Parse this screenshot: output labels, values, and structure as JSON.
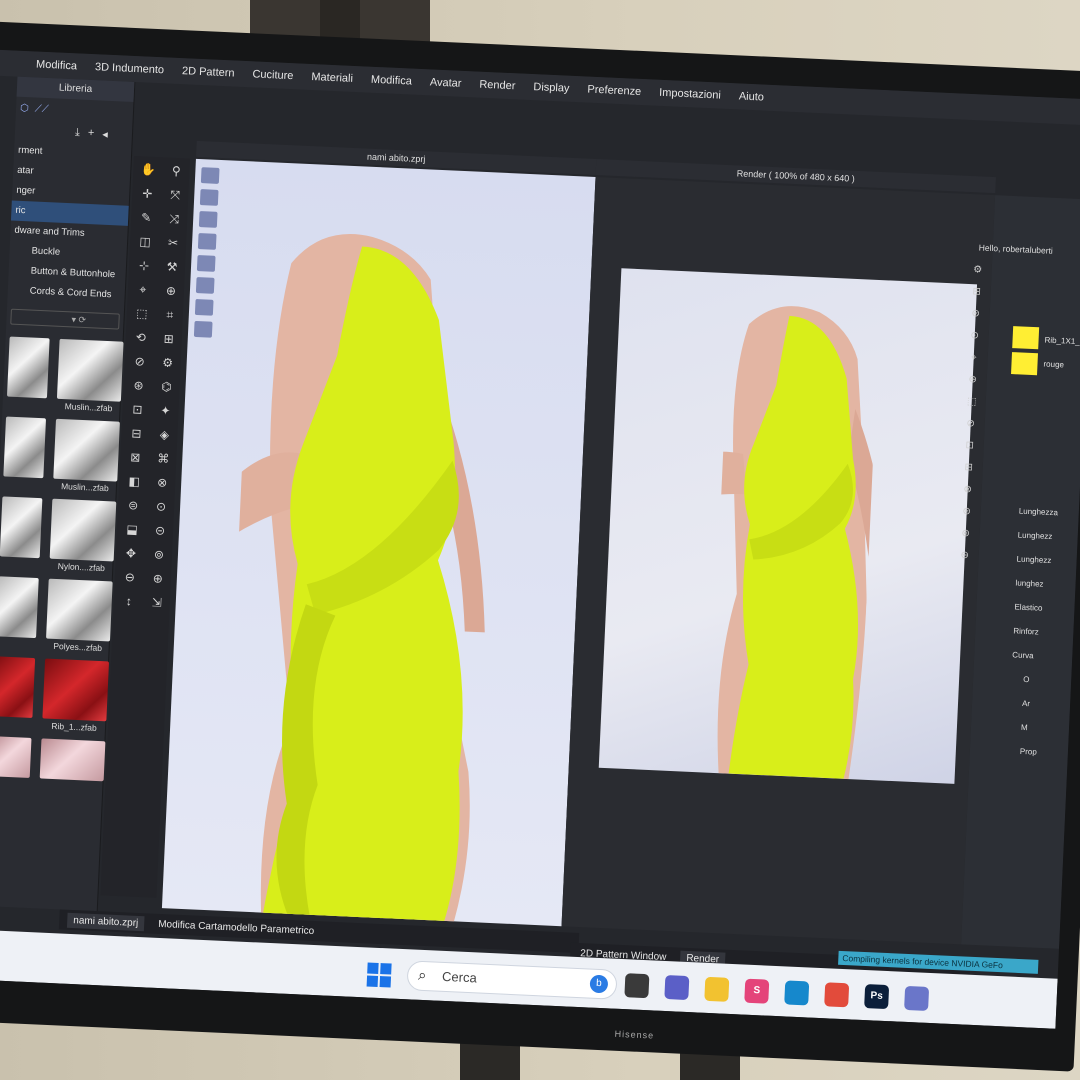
{
  "menu": {
    "items": [
      "Modifica",
      "3D Indumento",
      "2D Pattern",
      "Cuciture",
      "Materiali",
      "Modifica",
      "Avatar",
      "Render",
      "Display",
      "Preferenze",
      "Impostazioni",
      "Aiuto"
    ]
  },
  "library": {
    "title": "Libreria",
    "categories": [
      {
        "label": "rment",
        "selected": false,
        "indent": false
      },
      {
        "label": "atar",
        "selected": false,
        "indent": false
      },
      {
        "label": "nger",
        "selected": false,
        "indent": false
      },
      {
        "label": "ric",
        "selected": true,
        "indent": false
      },
      {
        "label": "dware and Trims",
        "selected": false,
        "indent": false
      },
      {
        "label": "Buckle",
        "selected": false,
        "indent": true
      },
      {
        "label": "Button & Buttonhole",
        "selected": false,
        "indent": true
      },
      {
        "label": "Cords & Cord Ends",
        "selected": false,
        "indent": true
      }
    ],
    "thumbnails": [
      {
        "label": "Muslin...zfab",
        "style": "white"
      },
      {
        "label": "Muslin...zfab",
        "style": "white"
      },
      {
        "label": "Nylon....zfab",
        "style": "white"
      },
      {
        "label": "Polyes...zfab",
        "style": "white"
      },
      {
        "label": "Rib_1...zfab",
        "style": "red"
      },
      {
        "label": "",
        "style": "pink"
      }
    ],
    "side_labels": [
      "fab",
      "fab"
    ]
  },
  "viewport": {
    "title": "nami abito.zprj"
  },
  "render": {
    "title": "Render ( 100% of 480 x 640 )"
  },
  "properties": {
    "user": "Hello, robertaluberti",
    "swatches": [
      {
        "label": "Rib_1X1_",
        "color": "#ffee33"
      },
      {
        "label": "rouge",
        "color": "#ffee33"
      }
    ],
    "fields": [
      "Lunghezza",
      "Lunghezz",
      "Lunghezz",
      "lunghez",
      "Elastico",
      "Rinforz",
      "Curva",
      "O",
      "Ar",
      "M",
      "Prop"
    ]
  },
  "tabs": {
    "left": [
      {
        "label": "nami abito.zprj",
        "active": true
      },
      {
        "label": "Modifica Cartamodello Parametrico",
        "active": false
      }
    ],
    "right": [
      {
        "label": "2D Pattern Window",
        "active": false
      },
      {
        "label": "Render",
        "active": true
      }
    ]
  },
  "status": {
    "message": "Compiling kernels for device NVIDIA GeFo"
  },
  "taskbar": {
    "search_placeholder": "Cerca",
    "apps": [
      {
        "name": "task-view",
        "label": "",
        "color": "#3a3a3a"
      },
      {
        "name": "meet",
        "label": "",
        "color": "#5b5fc7"
      },
      {
        "name": "file-explorer",
        "label": "",
        "color": "#f2c230"
      },
      {
        "name": "stagegate",
        "label": "S",
        "color": "#e4447a"
      },
      {
        "name": "edge",
        "label": "",
        "color": "#1688cc"
      },
      {
        "name": "chrome",
        "label": "",
        "color": "#e24b3b"
      },
      {
        "name": "photoshop",
        "label": "Ps",
        "color": "#0b1f3a"
      },
      {
        "name": "clo3d",
        "label": "",
        "color": "#6a76c9"
      }
    ]
  },
  "monitor": {
    "brand": "Hisense"
  },
  "colors": {
    "dress": "#d8ee1a",
    "accent": "#2f4f7a"
  }
}
